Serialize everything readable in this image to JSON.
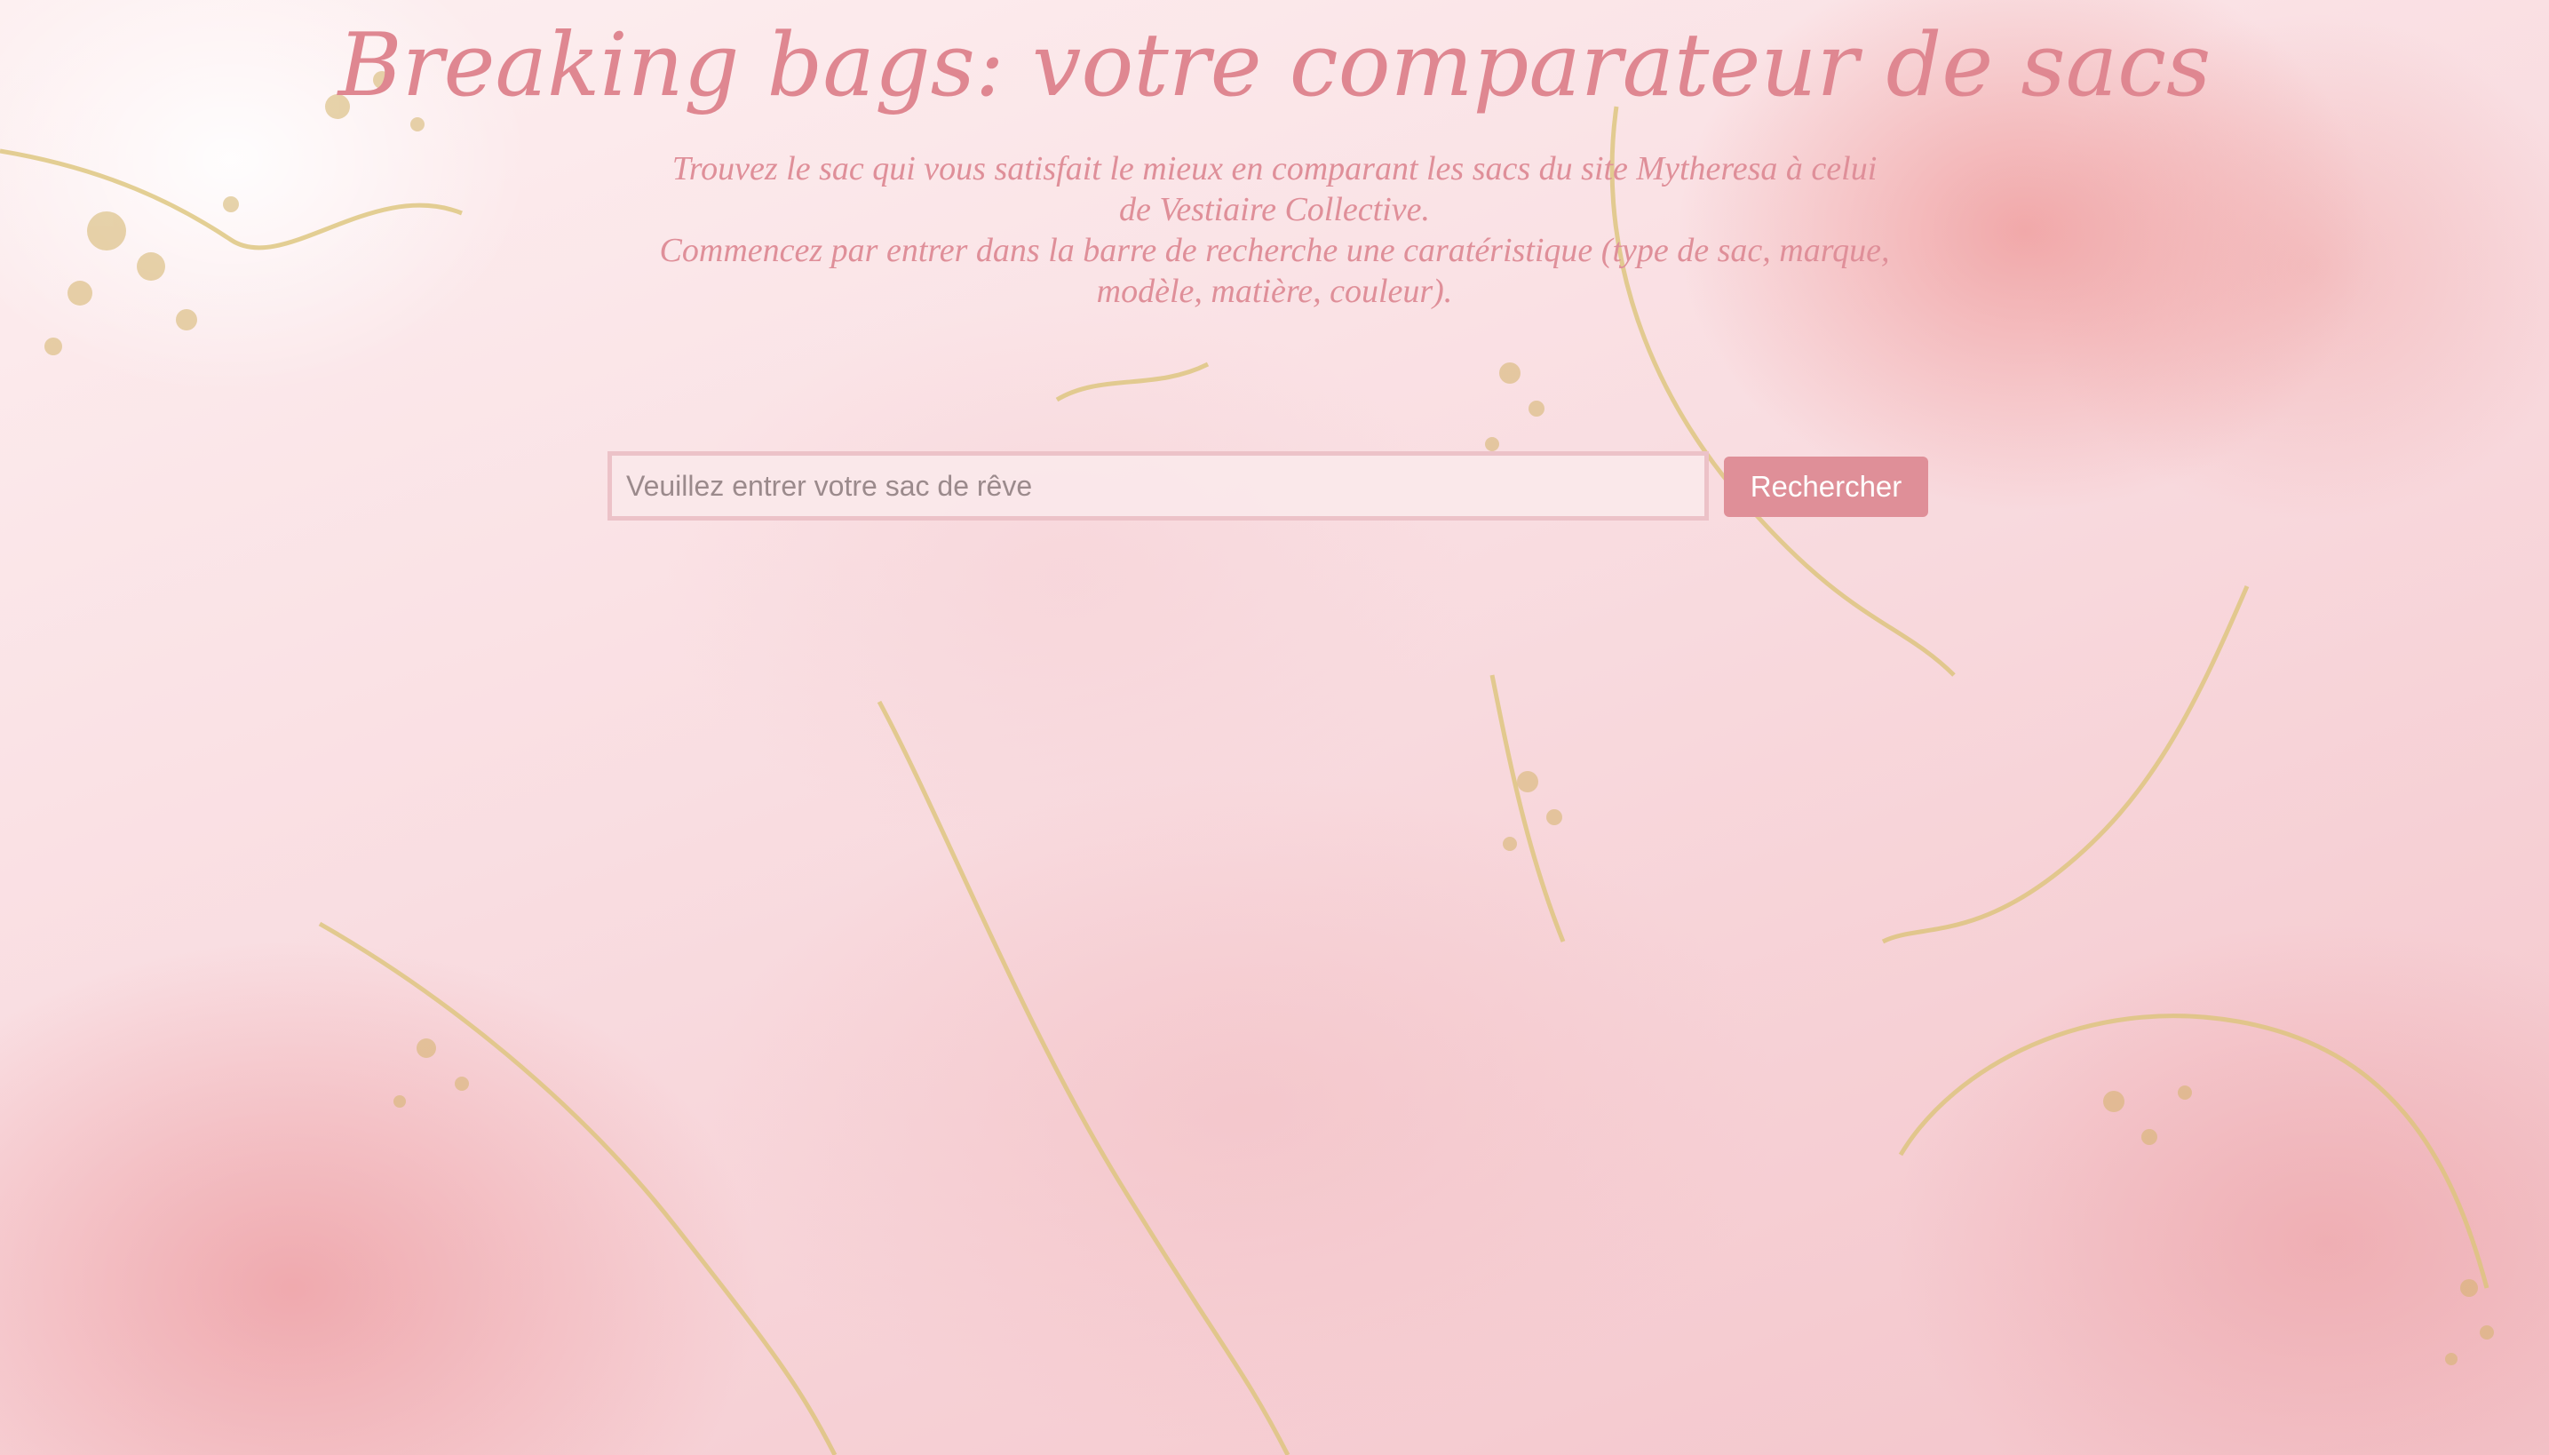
{
  "page": {
    "title": "Breaking bags: votre comparateur de sacs",
    "intro_line_1": "Trouvez le sac qui vous satisfait le mieux en comparant les sacs du site Mytheresa à celui de Vestiaire Collective.",
    "intro_line_2": "Commencez par entrer dans la barre de recherche une caratéristique (type de sac, marque, modèle, matière, couleur)."
  },
  "search": {
    "placeholder": "Veuillez entrer votre sac de rêve",
    "value": "",
    "button_label": "Rechercher"
  },
  "colors": {
    "accent": "#df8791",
    "button": "#df8f98",
    "gold": "#d9c27a"
  }
}
